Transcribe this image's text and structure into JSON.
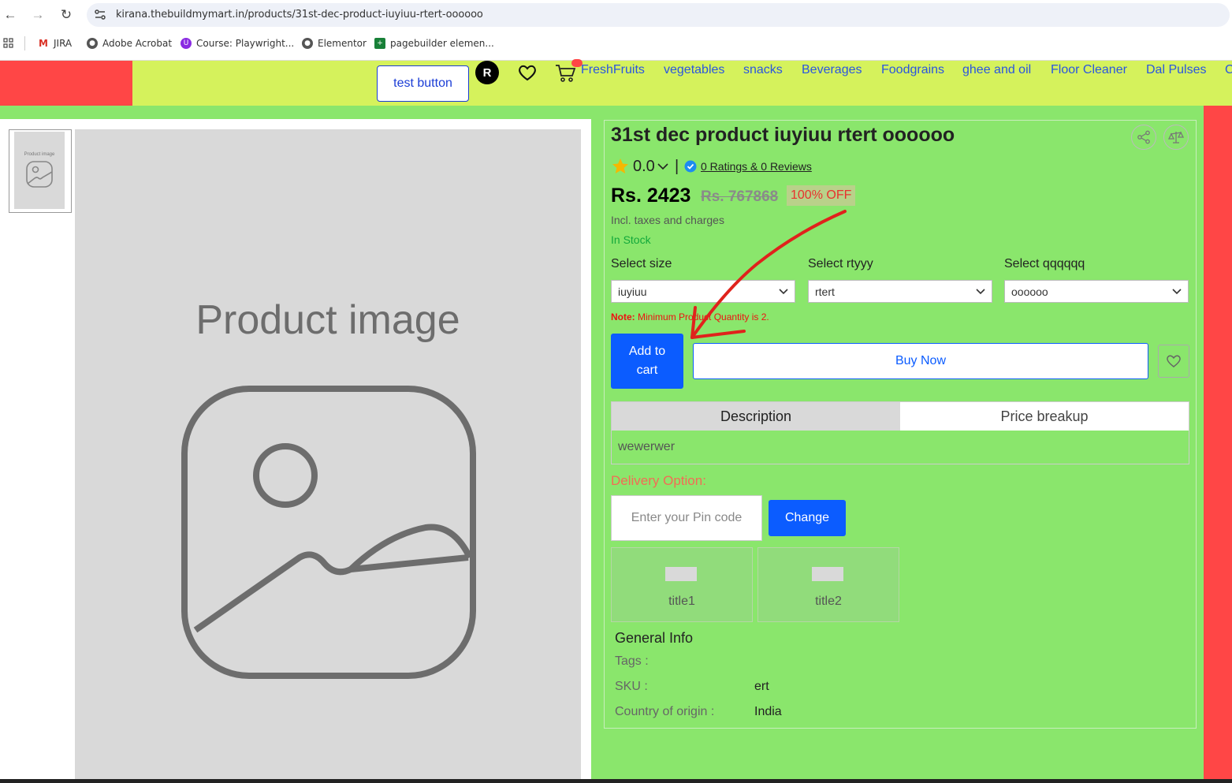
{
  "browser": {
    "url": "kirana.thebuildmymart.in/products/31st-dec-product-iuyiuu-rtert-oooooo",
    "bookmarks": [
      "JIRA",
      "Adobe Acrobat",
      "Course: Playwright...",
      "Elementor",
      "pagebuilder elemen..."
    ]
  },
  "header": {
    "test_button": "test button",
    "avatar_letter": "R",
    "nav": [
      "FreshFruits",
      "vegetables",
      "snacks",
      "Beverages",
      "Foodgrains",
      "ghee and oil",
      "Floor Cleaner",
      "Dal Pulses",
      "C"
    ]
  },
  "gallery": {
    "thumb_label": "Product image",
    "main_label": "Product image"
  },
  "product": {
    "title": "31st dec product iuyiuu rtert oooooo",
    "rating": "0.0",
    "separator": "|",
    "reviews": "0 Ratings  & 0 Reviews",
    "price": "Rs. 2423",
    "mrp": "Rs. 767868",
    "discount": "100% OFF",
    "incl": "Incl. taxes and charges",
    "stock": "In Stock",
    "selects": [
      {
        "label": "Select size",
        "value": "iuyiuu"
      },
      {
        "label": "Select rtyyy",
        "value": "rtert"
      },
      {
        "label": "Select qqqqqq",
        "value": "oooooo"
      }
    ],
    "note_label": "Note:",
    "note_text": "Minimum Product Quantity is 2.",
    "add_to_cart": "Add to cart",
    "buy_now": "Buy Now"
  },
  "tabs": {
    "description": "Description",
    "price_breakup": "Price breakup",
    "content": "wewerwer"
  },
  "delivery": {
    "label": "Delivery Option:",
    "pin_placeholder": "Enter your Pin code",
    "change": "Change"
  },
  "cards": [
    "title1",
    "title2"
  ],
  "general_info": {
    "title": "General Info",
    "tags_label": "Tags :",
    "sku_label": "SKU :",
    "sku_value": "ert",
    "origin_label": "Country of origin :",
    "origin_value": "India"
  },
  "colors": {
    "header_yellow": "#d5f25c",
    "accent_red": "#ff4646",
    "page_green": "#8ae66c",
    "primary_blue": "#0b5cff",
    "annotation_arrow": "#e0221c"
  }
}
